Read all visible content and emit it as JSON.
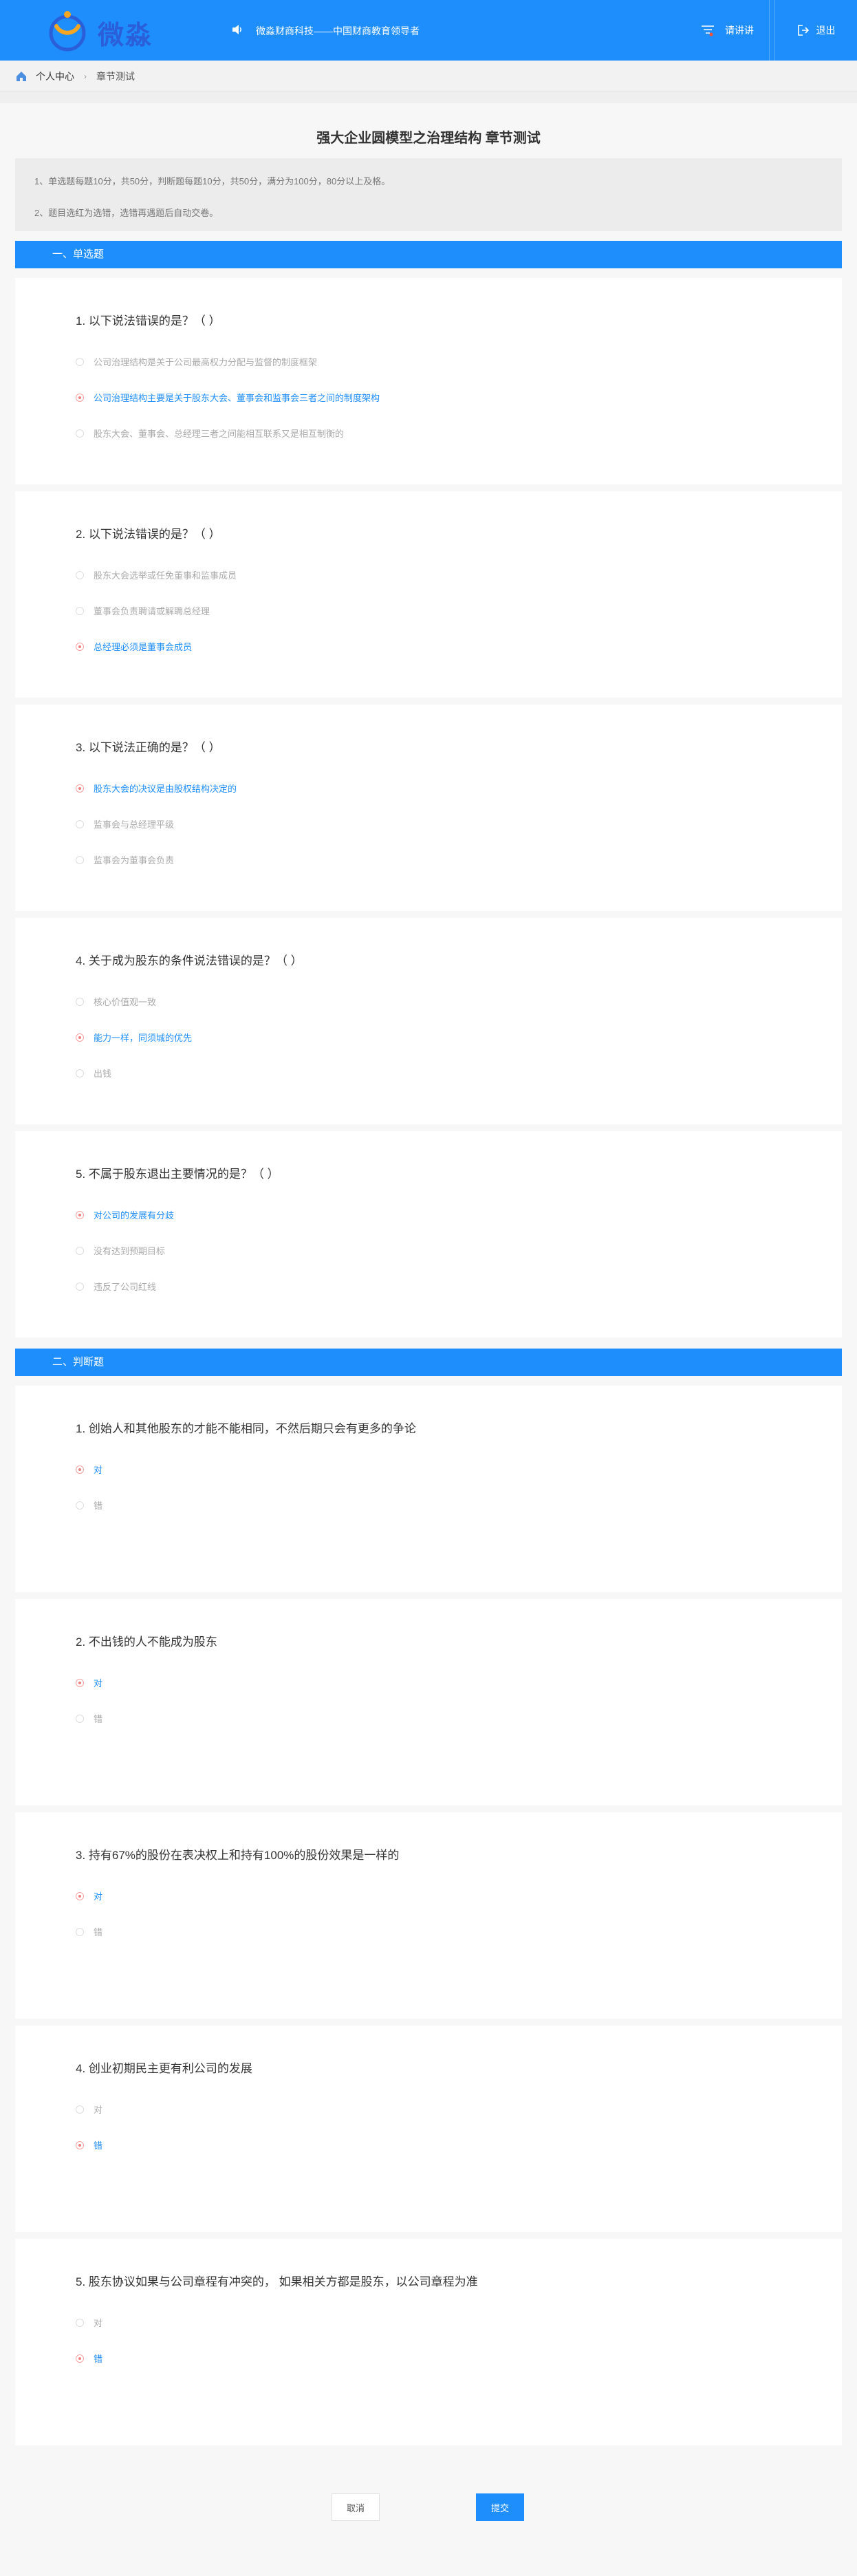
{
  "header": {
    "brand": "微淼",
    "slogan": "微淼财商科技——中国财商教育领导者",
    "ticket_label": "请讲讲",
    "logout_label": "退出"
  },
  "breadcrumb": {
    "home": "个人中心",
    "current": "章节测试"
  },
  "page": {
    "title": "强大企业圆模型之治理结构 章节测试",
    "notice_1": "1、单选题每题10分，共50分，判断题每题10分，共50分，满分为100分，80分以上及格。",
    "notice_2": "2、题目选红为选错，选错再遇题后自动交卷。"
  },
  "sections": {
    "single": "一、单选题",
    "judge": "二、判断题"
  },
  "single_questions": [
    {
      "title": "1. 以下说法错误的是？（ ）",
      "options": [
        "公司治理结构是关于公司最高权力分配与监督的制度框架",
        "公司治理结构主要是关于股东大会、董事会和监事会三者之间的制度架构",
        "股东大会、董事会、总经理三者之间能相互联系又是相互制衡的"
      ]
    },
    {
      "title": "2. 以下说法错误的是？（ ）",
      "options": [
        "股东大会选举或任免董事和监事成员",
        "董事会负责聘请或解聘总经理",
        "总经理必须是董事会成员"
      ]
    },
    {
      "title": "3. 以下说法正确的是？（ ）",
      "options": [
        "股东大会的决议是由股权结构决定的",
        "监事会与总经理平级",
        "监事会为董事会负责"
      ]
    },
    {
      "title": "4. 关于成为股东的条件说法错误的是？（ ）",
      "options": [
        "核心价值观一致",
        "能力一样，同须城的优先",
        "出钱"
      ]
    },
    {
      "title": "5. 不属于股东退出主要情况的是？（ ）",
      "options": [
        "对公司的发展有分歧",
        "没有达到预期目标",
        "违反了公司红线"
      ]
    }
  ],
  "judge_questions": [
    {
      "title": "1. 创始人和其他股东的才能不能相同，不然后期只会有更多的争论",
      "options": [
        "对",
        "错"
      ]
    },
    {
      "title": "2. 不出钱的人不能成为股东",
      "options": [
        "对",
        "错"
      ]
    },
    {
      "title": "3. 持有67%的股份在表决权上和持有100%的股份效果是一样的",
      "options": [
        "对",
        "错"
      ]
    },
    {
      "title": "4. 创业初期民主更有利公司的发展",
      "options": [
        "对",
        "错"
      ]
    },
    {
      "title": "5. 股东协议如果与公司章程有冲突的， 如果相关方都是股东，以公司章程为准",
      "options": [
        "对",
        "错"
      ]
    }
  ],
  "buttons": {
    "cancel": "取消",
    "submit": "提交"
  },
  "colors": {
    "primary": "#1e8efc",
    "selected_dot": "#f08080"
  }
}
